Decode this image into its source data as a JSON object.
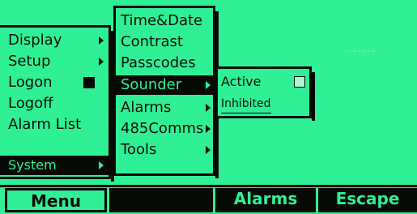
{
  "main_menu": {
    "items": [
      "Display",
      "Setup",
      "Logon",
      "Logoff",
      "Alarm List"
    ],
    "selected": "System"
  },
  "system_menu": {
    "items": [
      "Time&Date",
      "Contrast",
      "Passcodes",
      "Sounder",
      "Alarms",
      "485Comms",
      "Tools"
    ]
  },
  "sounder_menu": {
    "items": [
      "Active",
      "Inhibited"
    ]
  },
  "softkeys": [
    "Menu",
    "",
    "Alarms",
    "Escape"
  ],
  "colors": {
    "screen": "#2ff095",
    "ink": "#050a05"
  }
}
